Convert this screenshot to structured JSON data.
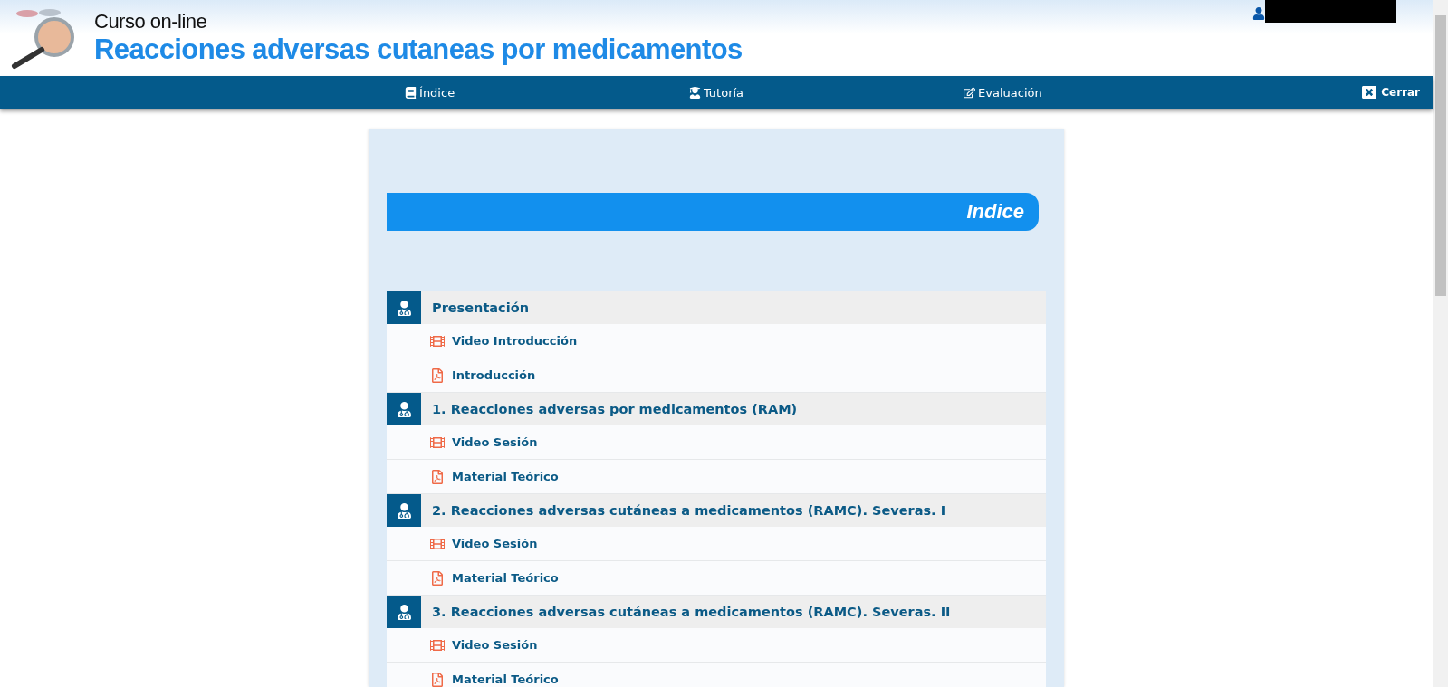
{
  "header": {
    "subtitle": "Curso on-line",
    "title": "Reacciones adversas cutaneas por medicamentos"
  },
  "nav": [
    {
      "label": "Índice",
      "kind": "book"
    },
    {
      "label": "Tutoría",
      "kind": "tutor"
    },
    {
      "label": "Evaluación",
      "kind": "edit"
    }
  ],
  "close_button": "Cerrar",
  "panel": {
    "heading": "Indice",
    "sections": [
      {
        "title": "Presentación",
        "items": [
          {
            "kind": "video",
            "label": "Video Introducción"
          },
          {
            "kind": "pdf",
            "label": "Introducción"
          }
        ]
      },
      {
        "title": "1. Reacciones adversas por medicamentos (RAM)",
        "items": [
          {
            "kind": "video",
            "label": "Video Sesión"
          },
          {
            "kind": "pdf",
            "label": "Material Teórico"
          }
        ]
      },
      {
        "title": "2. Reacciones adversas cutáneas a medicamentos (RAMC). Severas. I",
        "items": [
          {
            "kind": "video",
            "label": "Video Sesión"
          },
          {
            "kind": "pdf",
            "label": "Material Teórico"
          }
        ]
      },
      {
        "title": "3. Reacciones adversas cutáneas a medicamentos (RAMC). Severas. II",
        "items": [
          {
            "kind": "video",
            "label": "Video Sesión"
          },
          {
            "kind": "pdf",
            "label": "Material Teórico"
          }
        ]
      }
    ]
  }
}
